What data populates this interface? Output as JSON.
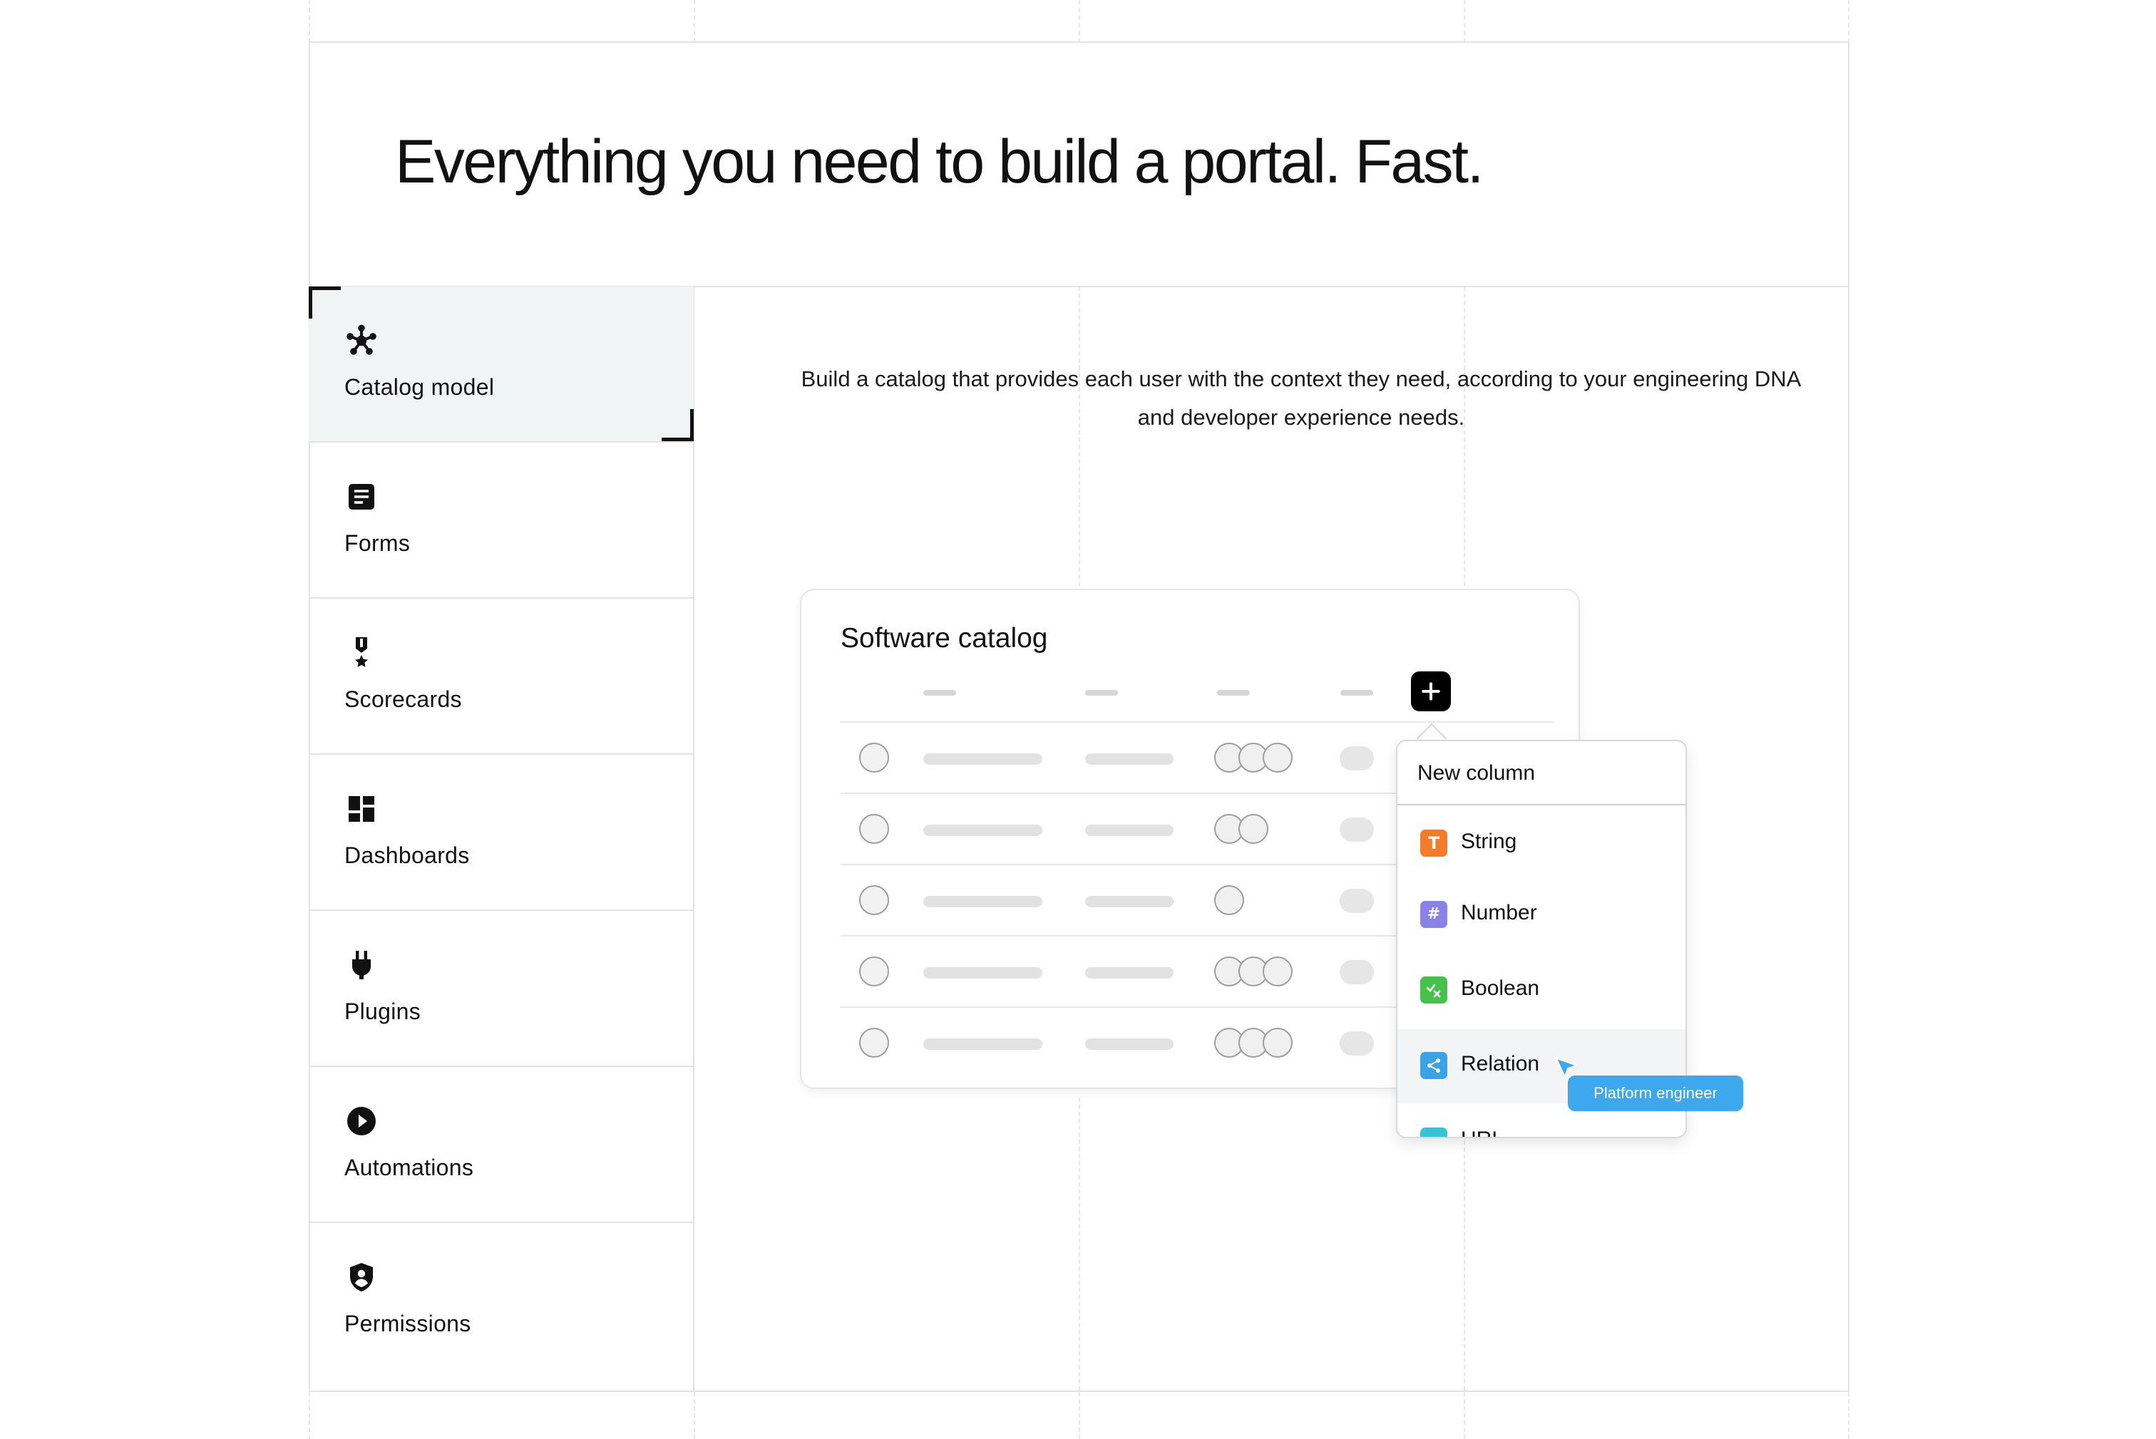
{
  "headline": "Everything you need to build a portal. Fast.",
  "sidebar": {
    "items": [
      {
        "label": "Catalog model",
        "icon": "network-icon",
        "active": true
      },
      {
        "label": "Forms",
        "icon": "document-icon"
      },
      {
        "label": "Scorecards",
        "icon": "medal-icon"
      },
      {
        "label": "Dashboards",
        "icon": "dashboard-icon"
      },
      {
        "label": "Plugins",
        "icon": "plug-icon"
      },
      {
        "label": "Automations",
        "icon": "play-circle-icon"
      },
      {
        "label": "Permissions",
        "icon": "shield-user-icon"
      }
    ]
  },
  "main": {
    "description": "Build a catalog that provides each user with the context they need, according to your engineering DNA and developer experience needs."
  },
  "catalog": {
    "title": "Software catalog",
    "add_button_icon": "plus-icon"
  },
  "dropdown": {
    "title": "New column",
    "items": [
      {
        "label": "String",
        "icon_glyph": "T",
        "color": "#f47b2a"
      },
      {
        "label": "Number",
        "icon_glyph": "#",
        "color": "#8a82e8"
      },
      {
        "label": "Boolean",
        "icon_glyph": "",
        "color": "#46c24a"
      },
      {
        "label": "Relation",
        "icon_glyph": "",
        "color": "#3aa3e6"
      },
      {
        "label": "URL",
        "icon_glyph": "",
        "color": "#38c2d6"
      }
    ]
  },
  "tooltip": {
    "label": "Platform engineer",
    "color": "#3ea8ef"
  }
}
